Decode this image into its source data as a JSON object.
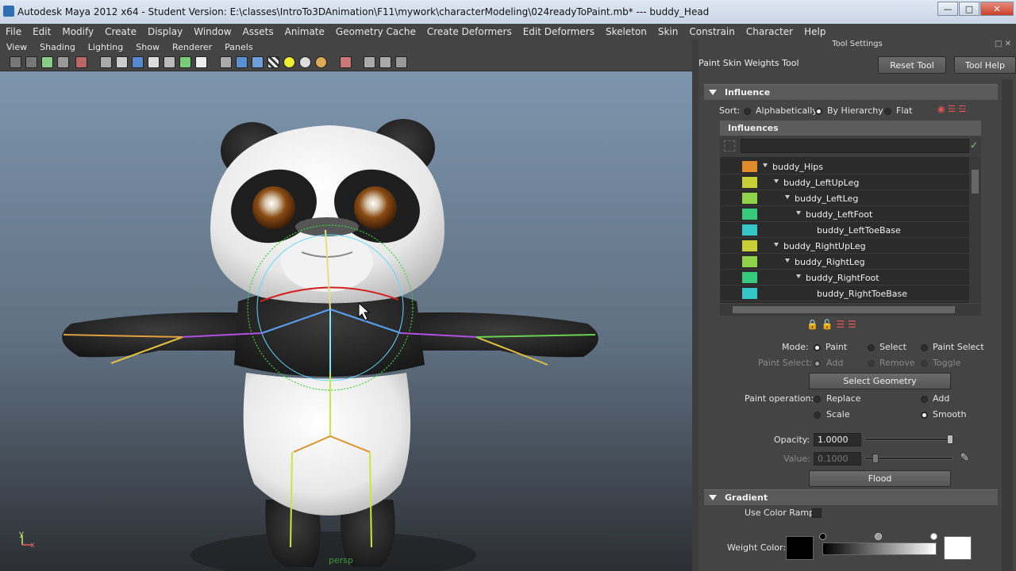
{
  "window": {
    "title": "Autodesk Maya 2012 x64 - Student Version: E:\\classes\\IntroTo3DAnimation\\F11\\mywork\\characterModeling\\024readyToPaint.mb*   ---   buddy_Head"
  },
  "menu": [
    "File",
    "Edit",
    "Modify",
    "Create",
    "Display",
    "Window",
    "Assets",
    "Animate",
    "Geometry Cache",
    "Create Deformers",
    "Edit Deformers",
    "Skeleton",
    "Skin",
    "Constrain",
    "Character",
    "Help"
  ],
  "panel_menu": [
    "View",
    "Shading",
    "Lighting",
    "Show",
    "Renderer",
    "Panels"
  ],
  "viewport": {
    "camera": "persp",
    "axis_y": "y",
    "axis_x": "x"
  },
  "tool_settings": {
    "header": "Tool Settings",
    "tool_name": "Paint Skin Weights Tool",
    "reset_button": "Reset Tool",
    "help_button": "Tool Help",
    "influence": {
      "section": "Influence",
      "sort_label": "Sort:",
      "sort_options": [
        "Alphabetically",
        "By Hierarchy",
        "Flat"
      ],
      "sort_selected": "By Hierarchy",
      "list_header": "Influences",
      "search_value": "",
      "items": [
        {
          "name": "buddy_Hips",
          "color": "#e08a2a",
          "depth": 0,
          "expand": true
        },
        {
          "name": "buddy_LeftUpLeg",
          "color": "#c8cf34",
          "depth": 1,
          "expand": true
        },
        {
          "name": "buddy_LeftLeg",
          "color": "#8fd24a",
          "depth": 2,
          "expand": true
        },
        {
          "name": "buddy_LeftFoot",
          "color": "#37c97c",
          "depth": 3,
          "expand": true
        },
        {
          "name": "buddy_LeftToeBase",
          "color": "#35c7c7",
          "depth": 4,
          "expand": false
        },
        {
          "name": "buddy_RightUpLeg",
          "color": "#c8cf34",
          "depth": 1,
          "expand": true
        },
        {
          "name": "buddy_RightLeg",
          "color": "#8fd24a",
          "depth": 2,
          "expand": true
        },
        {
          "name": "buddy_RightFoot",
          "color": "#37c97c",
          "depth": 3,
          "expand": true
        },
        {
          "name": "buddy_RightToeBase",
          "color": "#35c7c7",
          "depth": 4,
          "expand": false
        }
      ]
    },
    "mode": {
      "label": "Mode:",
      "options": [
        "Paint",
        "Select",
        "Paint Select"
      ],
      "selected": "Paint",
      "paint_select_label": "Paint Select:",
      "paint_select_options": [
        "Add",
        "Remove",
        "Toggle"
      ],
      "select_geometry_button": "Select Geometry"
    },
    "paint_operation": {
      "label": "Paint operation:",
      "options": [
        "Replace",
        "Add",
        "Scale",
        "Smooth"
      ],
      "selected": "Smooth"
    },
    "opacity": {
      "label": "Opacity:",
      "value": "1.0000",
      "fraction": 1.0
    },
    "value": {
      "label": "Value:",
      "value": "0.1000",
      "fraction": 0.1
    },
    "flood_button": "Flood",
    "gradient": {
      "section": "Gradient",
      "use_color_ramp": "Use Color Ramp",
      "weight_color": "Weight Color:"
    }
  }
}
